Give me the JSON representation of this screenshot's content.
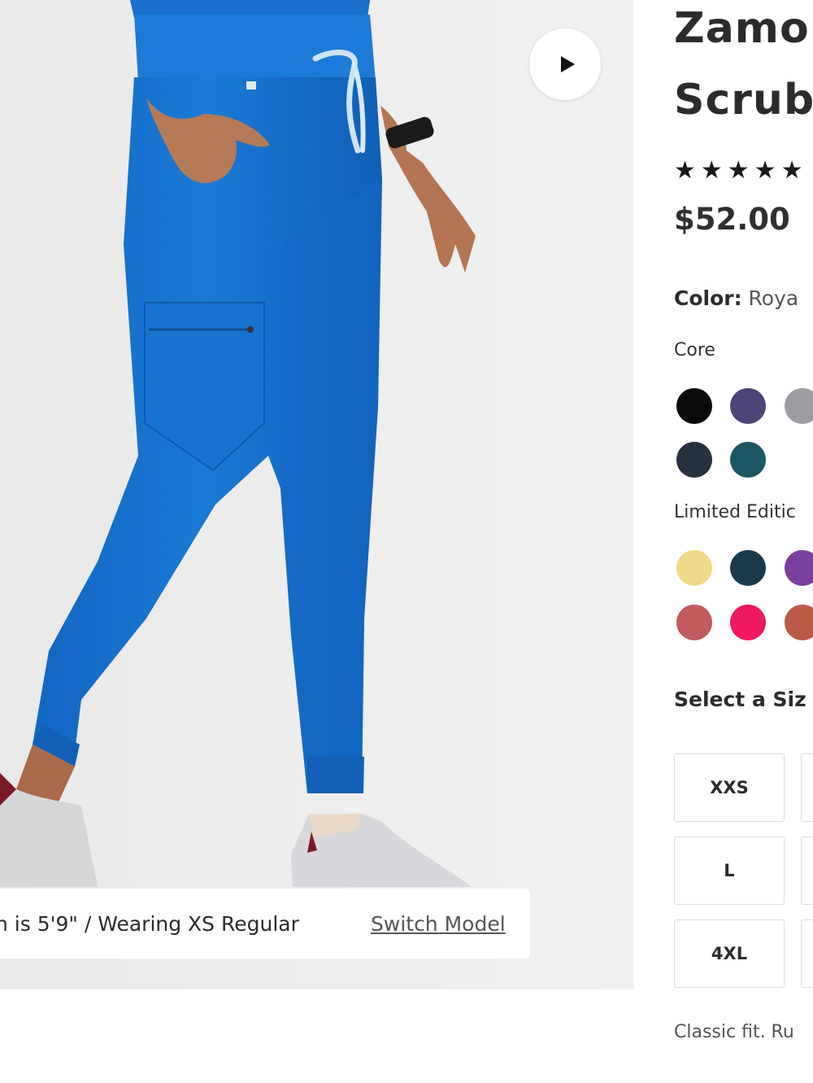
{
  "product": {
    "title_line1": "Zamo",
    "title_line2": "Scrub",
    "stars": "★★★★★",
    "price": "$52.00",
    "color_label": "Color:",
    "color_value": "Roya",
    "core_label": "Core",
    "limited_label": "Limited Editic",
    "size_label": "Select a Siz",
    "sizes": [
      "XXS",
      "L",
      "4XL"
    ],
    "fit_text": "Classic fit. Ru"
  },
  "media": {
    "model_info": "n is 5'9\" / Wearing XS Regular",
    "switch_model": "Switch Model",
    "play_icon": "play-icon"
  },
  "colors": {
    "core": [
      "#0b0b0c",
      "#4a4576",
      "#9c9ca3",
      "#27303f",
      "#1c5562"
    ],
    "limited": [
      "#f0d98a",
      "#1c3a4c",
      "#7b3f9e",
      "#c05a5c",
      "#f0185e",
      "#b95a48"
    ],
    "brand_blue": "#1976d2"
  }
}
